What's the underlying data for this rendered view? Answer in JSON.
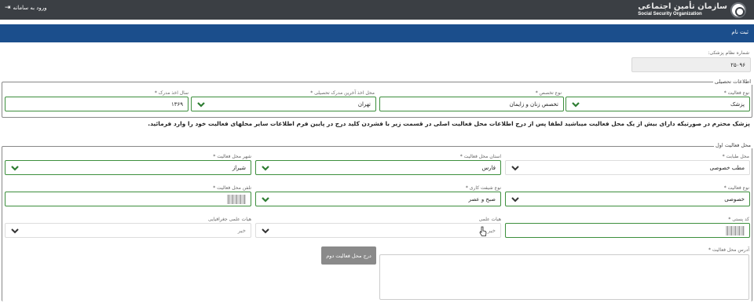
{
  "header": {
    "org_name_fa": "سازمان تأمین اجتماعی",
    "org_name_en": "Social Security Organization",
    "login_label": "ورود به سامانه"
  },
  "title": "ثبت نام",
  "medical_no": {
    "label": "شماره نظام پزشکی:",
    "value": "۲۵۰۹۶"
  },
  "education": {
    "legend": "اطلاعات تحصیلی",
    "activity_type": {
      "label": "نوع فعالیت",
      "value": "پزشک"
    },
    "specialty": {
      "label": "نوع تخصص",
      "value": "تخصص زنان و زایمان"
    },
    "degree_place": {
      "label": "محل اخذ آخرین مدرک تحصیلی",
      "value": "تهران"
    },
    "degree_year": {
      "label": "سال اخذ مدرک",
      "value": "۱۳۶۹"
    }
  },
  "note": "پزشک محترم در صورتیکه دارای بیش از یک محل فعالیت میباشید لطفا پس از درج اطلاعات محل فعالیت اصلی در قسمت زیر با فشردن کلید درج در پایین فرم اطلاعات سایر محلهای فعالیت خود را وارد فرمائید.",
  "first_place": {
    "legend": "محل فعالیت اول",
    "place_type": {
      "label": "محل طبابت",
      "value": "مطب خصوصی"
    },
    "province": {
      "label": "استان محل فعالیت",
      "value": "فارس"
    },
    "city": {
      "label": "شهر محل فعالیت",
      "value": "شیراز"
    },
    "activity_kind": {
      "label": "نوع فعالیت",
      "value": "خصوصی"
    },
    "shift": {
      "label": "نوع شیفت کاری",
      "value": "صبح و عصر"
    },
    "phone": {
      "label": "تلفن محل فعالیت"
    },
    "postal_code": {
      "label": "کد پستی"
    },
    "faculty": {
      "label": "هیات علمی",
      "value": "خیر"
    },
    "faculty_geo": {
      "label": "هیات علمی جغرافیایی",
      "value": "خیر"
    },
    "address": {
      "label": "آدرس محل فعالیت"
    },
    "add_second_button": "درج محل فعالیت دوم"
  },
  "colors": {
    "header": "#3b3f44",
    "titlebar": "#1b4e8c",
    "valid_border": "#3d8f3d",
    "chevron": "#2e7d32"
  }
}
